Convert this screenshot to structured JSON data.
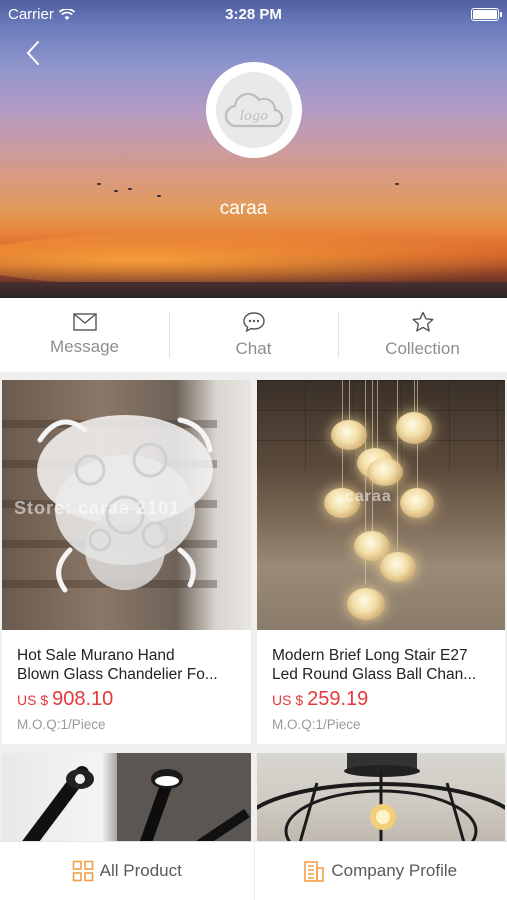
{
  "status_bar": {
    "carrier": "Carrier",
    "time": "3:28 PM"
  },
  "shop": {
    "name": "caraa",
    "logo_text": "logo"
  },
  "actions": [
    {
      "label": "Message",
      "icon": "envelope-icon"
    },
    {
      "label": "Chat",
      "icon": "chat-bubble-icon"
    },
    {
      "label": "Collection",
      "icon": "star-icon"
    }
  ],
  "products": [
    {
      "title_line1": "Hot Sale Murano Hand",
      "title_line2": "Blown Glass Chandelier Fo...",
      "currency": "US $",
      "price": "908.10",
      "moq": "M.O.Q:1/Piece",
      "watermark": "Store: caraa 2101"
    },
    {
      "title_line1": "Modern Brief Long Stair E27",
      "title_line2": "Led Round Glass Ball Chan...",
      "currency": "US $",
      "price": "259.19",
      "moq": "M.O.Q:1/Piece",
      "watermark": "caraa"
    }
  ],
  "tabbar": [
    {
      "label": "All Product",
      "icon": "grid-icon"
    },
    {
      "label": "Company Profile",
      "icon": "building-icon"
    }
  ],
  "colors": {
    "price_red": "#e4393c",
    "tab_icon_orange": "#f0a04b",
    "muted_text": "#8e8e8e"
  }
}
